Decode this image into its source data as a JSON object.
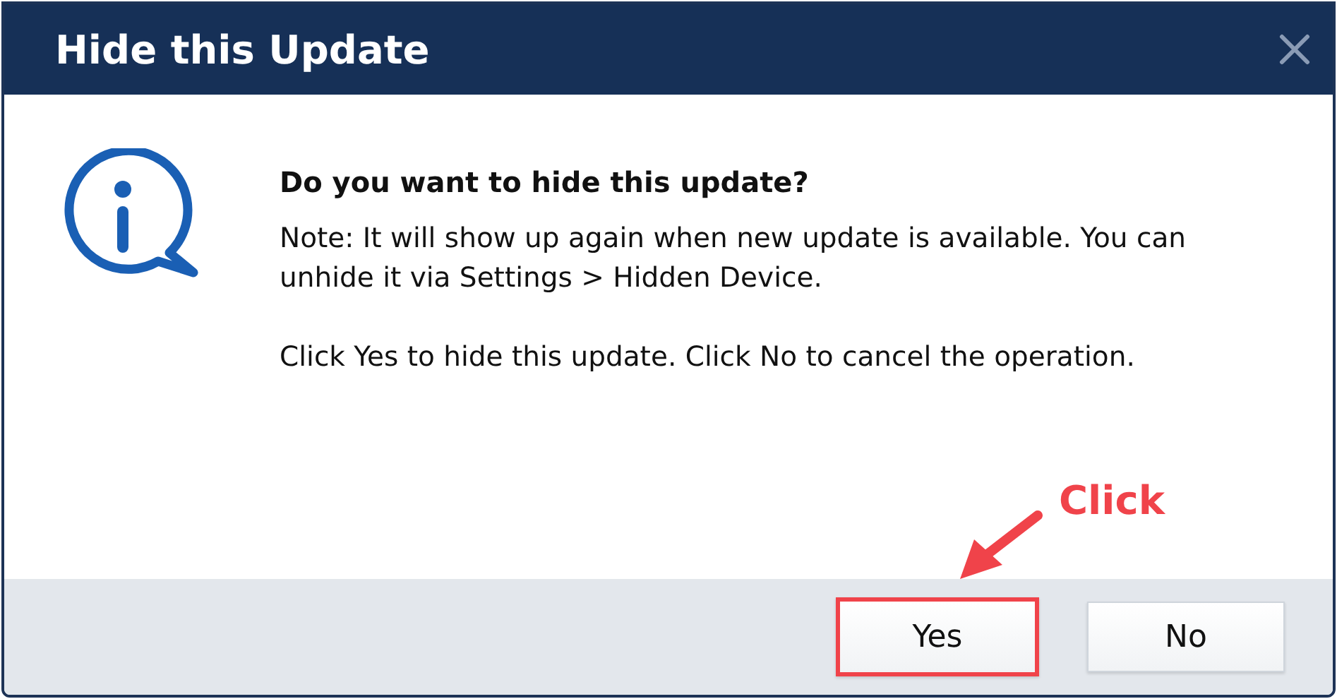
{
  "window": {
    "title": "Hide this Update"
  },
  "message": {
    "heading": "Do you want to hide this update?",
    "paragraphs": [
      "Note: It will show up again when new update is available. You can unhide it via Settings > Hidden Device.",
      "Click Yes to hide this update. Click No to cancel the operation."
    ]
  },
  "buttons": [
    {
      "label": "Yes",
      "highlighted": true
    },
    {
      "label": "No",
      "highlighted": false
    }
  ],
  "annotation": {
    "label": "Click"
  }
}
